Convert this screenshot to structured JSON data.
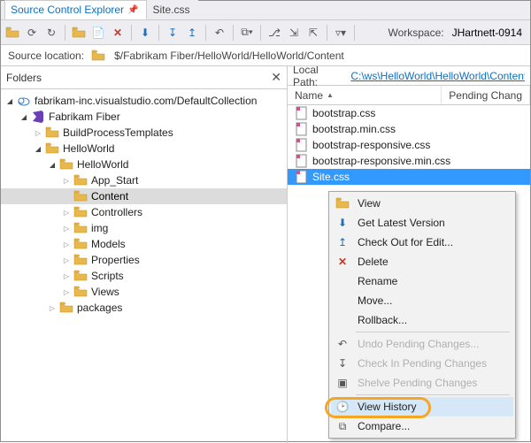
{
  "tabs": {
    "sce": "Source Control Explorer",
    "file": "Site.css"
  },
  "toolbar": {
    "workspace_label": "Workspace:",
    "workspace_value": "JHartnett-0914"
  },
  "source_location": {
    "label": "Source location:",
    "path": "$/Fabrikam Fiber/HelloWorld/HelloWorld/Content"
  },
  "folders_header": "Folders",
  "tree": {
    "root": "fabrikam-inc.visualstudio.com/DefaultCollection",
    "project": "Fabrikam Fiber",
    "bpt": "BuildProcessTemplates",
    "hw1": "HelloWorld",
    "hw2": "HelloWorld",
    "app_start": "App_Start",
    "content": "Content",
    "controllers": "Controllers",
    "img": "img",
    "models": "Models",
    "properties": "Properties",
    "scripts": "Scripts",
    "views": "Views",
    "packages": "packages"
  },
  "local_path": {
    "label": "Local Path:",
    "value": "C:\\ws\\HelloWorld\\HelloWorld\\Content"
  },
  "columns": {
    "name": "Name",
    "pending": "Pending Chang"
  },
  "files": {
    "f0": "bootstrap.css",
    "f1": "bootstrap.min.css",
    "f2": "bootstrap-responsive.css",
    "f3": "bootstrap-responsive.min.css",
    "f4": "Site.css"
  },
  "ctx": {
    "view": "View",
    "get_latest": "Get Latest Version",
    "checkout": "Check Out for Edit...",
    "delete": "Delete",
    "rename": "Rename",
    "move": "Move...",
    "rollback": "Rollback...",
    "undo": "Undo Pending Changes...",
    "checkin": "Check In Pending Changes",
    "shelve": "Shelve Pending Changes",
    "history": "View History",
    "compare": "Compare..."
  }
}
